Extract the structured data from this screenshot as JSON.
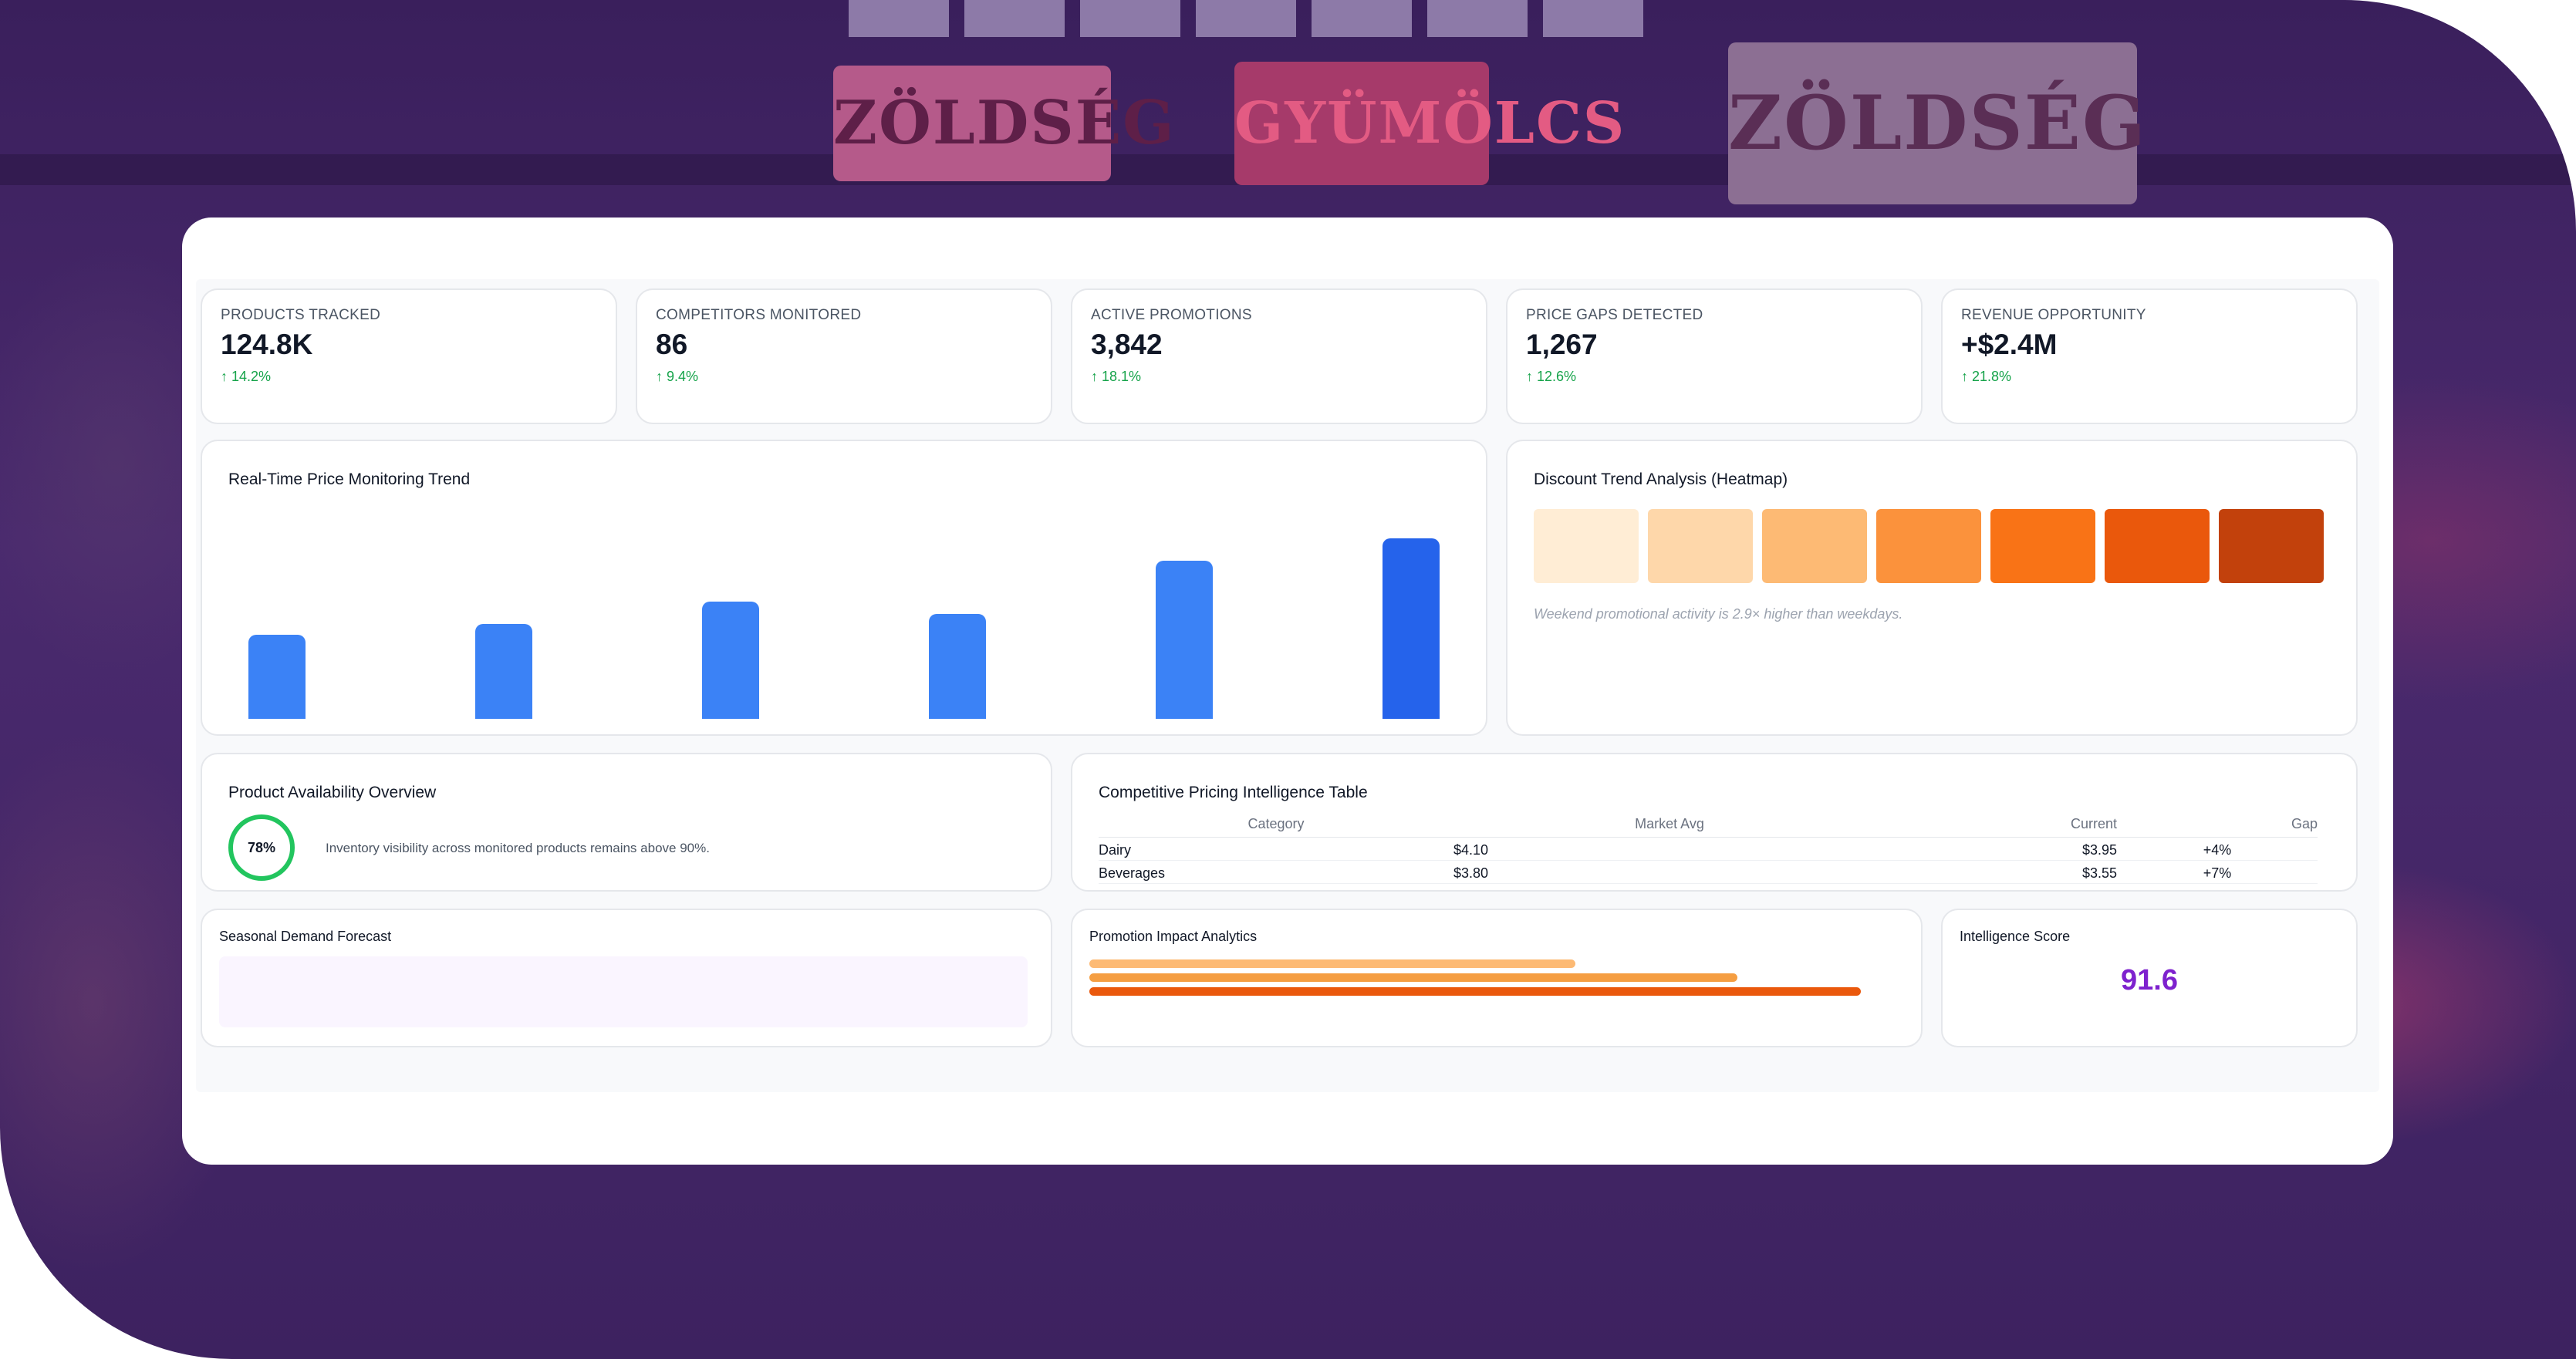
{
  "background": {
    "signs": [
      "ZÖLDSÉG",
      "GYÜMÖLCS",
      "ZÖLDSÉG"
    ]
  },
  "kpis": [
    {
      "label": "PRODUCTS TRACKED",
      "value": "124.8K",
      "delta": "↑ 14.2%"
    },
    {
      "label": "COMPETITORS MONITORED",
      "value": "86",
      "delta": "↑ 9.4%"
    },
    {
      "label": "ACTIVE PROMOTIONS",
      "value": "3,842",
      "delta": "↑ 18.1%"
    },
    {
      "label": "PRICE GAPS DETECTED",
      "value": "1,267",
      "delta": "↑ 12.6%"
    },
    {
      "label": "REVENUE OPPORTUNITY",
      "value": "+$2.4M",
      "delta": "↑ 21.8%"
    }
  ],
  "price_trend": {
    "title": "Real-Time Price Monitoring Trend"
  },
  "chart_data": {
    "type": "bar",
    "values": [
      48,
      54,
      67,
      60,
      90,
      103
    ],
    "ylim": [
      0,
      110
    ]
  },
  "heatmap": {
    "title": "Discount Trend Analysis (Heatmap)",
    "colors": [
      "#ffedd5",
      "#fed7aa",
      "#fdba74",
      "#fb923c",
      "#f97316",
      "#ea580c",
      "#c2410c"
    ],
    "note": "Weekend promotional activity is 2.9× higher than weekdays."
  },
  "availability": {
    "title": "Product Availability Overview",
    "percent": "78%",
    "text": "Inventory visibility across monitored products remains above 90%."
  },
  "pricing_table": {
    "title": "Competitive Pricing Intelligence Table",
    "headers": [
      "Category",
      "Market Avg",
      "Current",
      "Gap"
    ],
    "rows": [
      {
        "category": "Dairy",
        "market_avg": "$4.10",
        "current": "$3.95",
        "gap": "+4%"
      },
      {
        "category": "Beverages",
        "market_avg": "$3.80",
        "current": "$3.55",
        "gap": "+7%"
      }
    ]
  },
  "seasonal": {
    "title": "Seasonal Demand Forecast"
  },
  "promotion": {
    "title": "Promotion Impact Analytics",
    "bars": [
      {
        "fraction": 0.63,
        "color": "#fdba74"
      },
      {
        "fraction": 0.84,
        "color": "#f59e42"
      },
      {
        "fraction": 1.0,
        "color": "#ea580c"
      }
    ]
  },
  "intelligence": {
    "title": "Intelligence Score",
    "score": "91.6"
  }
}
